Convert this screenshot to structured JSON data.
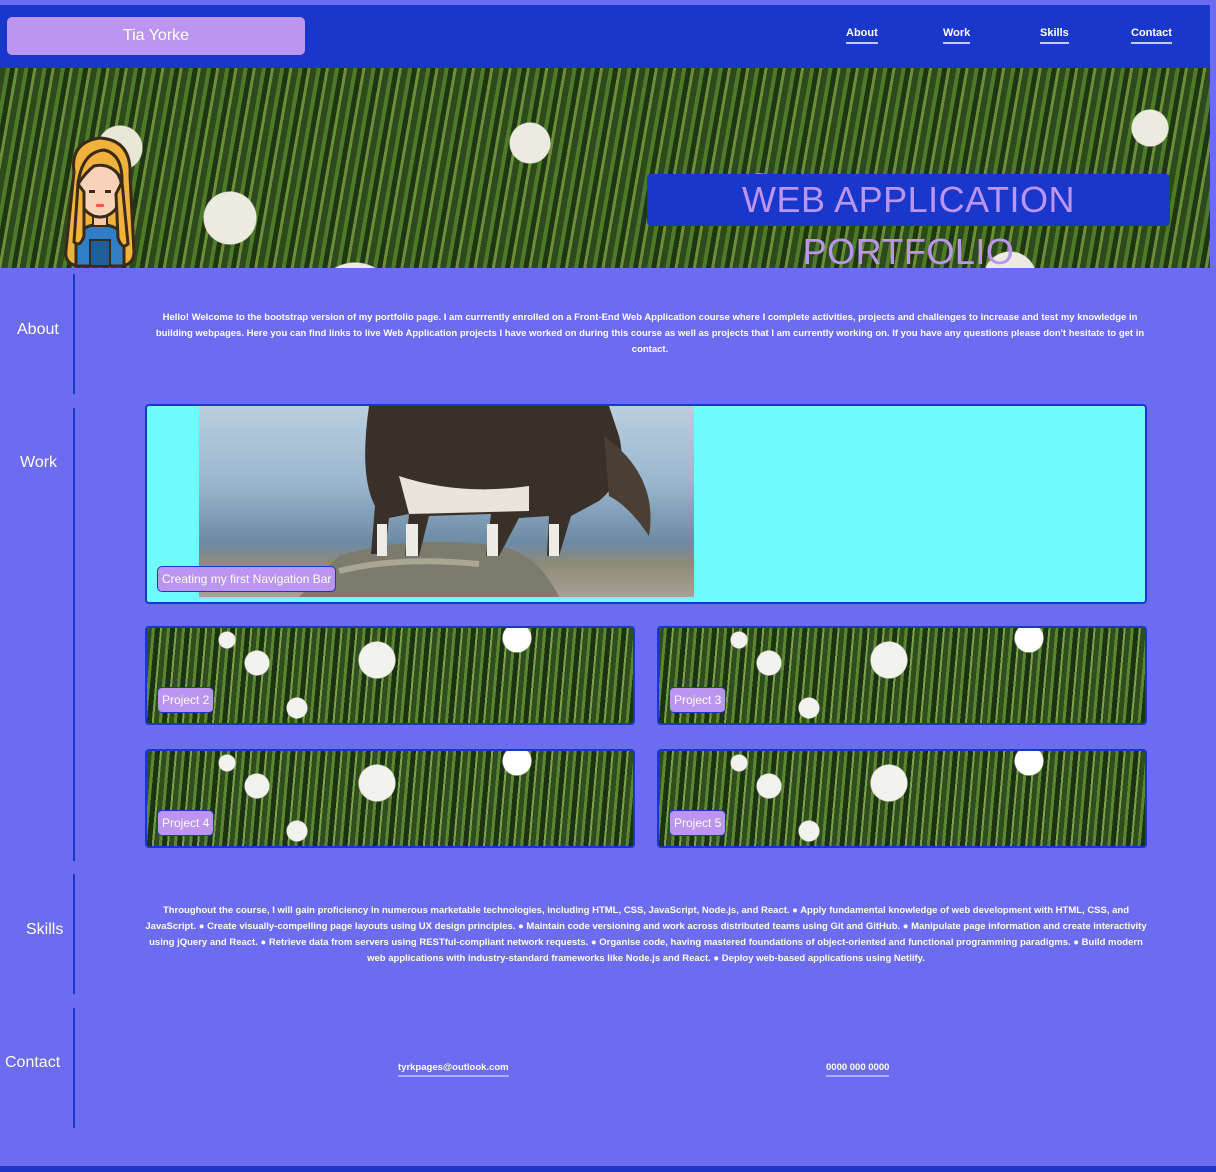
{
  "nav": {
    "brand": "Tia Yorke",
    "links": [
      "About",
      "Work",
      "Skills",
      "Contact"
    ]
  },
  "hero": {
    "title": "WEB APPLICATION PORTFOLIO"
  },
  "about": {
    "label": "About",
    "text": "Hello! Welcome to the bootstrap version of my portfolio page. I am currrently enrolled on a Front-End Web Application course where I complete activities, projects and challenges to increase and test my knowledge in building webpages. Here you can find links to live Web Application projects I have worked on during this course as well as projects that I am currently working on. If you have any questions please don't hesitate to get in contact."
  },
  "work": {
    "label": "Work",
    "projects": [
      "Creating my first Navigation Bar",
      "Project 2",
      "Project 3",
      "Project 4",
      "Project 5"
    ]
  },
  "skills": {
    "label": "Skills",
    "text": "Throughout the course, I will gain proficiency in numerous marketable technologies, including HTML, CSS, JavaScript, Node.js, and React. ● Apply fundamental knowledge of web development with HTML, CSS, and JavaScript. ● Create visually-compelling page layouts using UX design principles. ● Maintain code versioning and work across distributed teams using Git and GitHub. ● Manipulate page information and create interactivity using jQuery and React. ● Retrieve data from servers using RESTful-compliant network requests. ● Organise code, having mastered foundations of object-oriented and functional programming paradigms. ● Build modern web applications with industry-standard frameworks like Node.js and React. ● Deploy web-based applications using Netlify."
  },
  "contact": {
    "label": "Contact",
    "email": "tyrkpages@outlook.com",
    "phone": "0000 000 0000"
  },
  "colors": {
    "navy": "#1a37cc",
    "lilac": "#bb95f0",
    "periwinkle": "#6b6cf0",
    "cyan": "#6ffafc"
  }
}
